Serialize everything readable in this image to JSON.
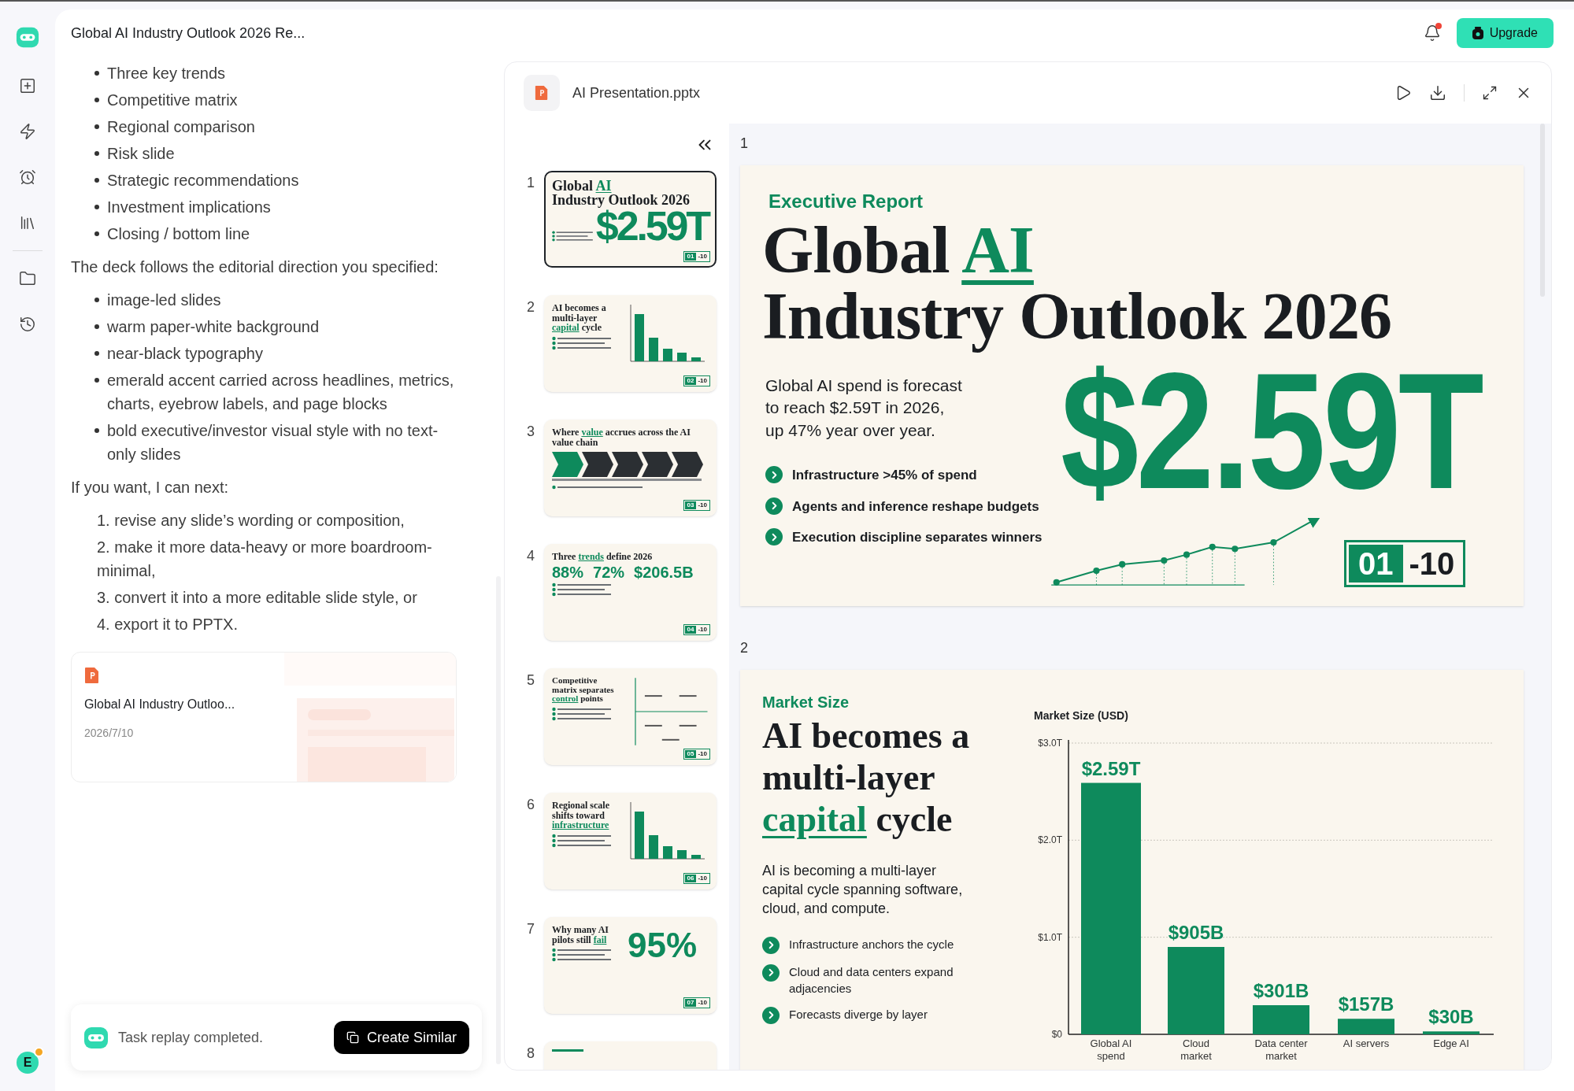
{
  "app": {
    "title": "Global AI Industry Outlook 2026 Re...",
    "avatar_letter": "E",
    "upgrade_label": "Upgrade",
    "has_notification": true
  },
  "chat": {
    "blocks": [
      {
        "kind": "bullets",
        "items": [
          "Three key trends",
          "Competitive matrix",
          "Regional comparison",
          "Risk slide",
          "Strategic recommendations",
          "Investment implications",
          "Closing / bottom line"
        ]
      },
      {
        "kind": "paragraph",
        "text": "The deck follows the editorial direction you specified:"
      },
      {
        "kind": "bullets",
        "items": [
          "image-led slides",
          "warm paper-white background",
          "near-black typography",
          "emerald accent carried across headlines, metrics, charts, eyebrow labels, and page blocks",
          "bold executive/investor visual style with no text-only slides"
        ]
      },
      {
        "kind": "paragraph",
        "text": "If you want, I can next:"
      },
      {
        "kind": "numbered",
        "items": [
          "1. revise any slide’s wording or composition,",
          "2. make it more data-heavy or more boardroom-minimal,",
          "3. convert it into a more editable slide style, or",
          "4. export it to PPTX."
        ]
      }
    ],
    "file_card": {
      "name": "Global AI Industry Outloo...",
      "date": "2026/7/10"
    },
    "status": {
      "text": "Task replay completed.",
      "button": "Create Similar"
    }
  },
  "preview": {
    "file_name": "AI Presentation.pptx",
    "thumbnails": [
      {
        "kind": "cover",
        "number": "1",
        "selected": true,
        "title": {
          "before": "Global ",
          "accent": "AI",
          "after": "\nIndustry Outlook 2026"
        },
        "stat": "$2.59T",
        "page": "01",
        "total": "-10"
      },
      {
        "kind": "bars",
        "number": "2",
        "selected": false,
        "title": {
          "before": "AI becomes a multi-layer ",
          "accent": "capital",
          "after": " cycle"
        },
        "page": "02",
        "total": "-10"
      },
      {
        "kind": "chain",
        "number": "3",
        "selected": false,
        "title": {
          "before": "Where ",
          "accent": "value",
          "after": " accrues across the AI value chain"
        },
        "page": "03",
        "total": "-10"
      },
      {
        "kind": "stats",
        "number": "4",
        "selected": false,
        "title": {
          "before": "Three ",
          "accent": "trends",
          "after": " define 2026"
        },
        "stats": [
          "88%",
          "72%",
          "$206.5B"
        ],
        "page": "04",
        "total": "-10"
      },
      {
        "kind": "matrix",
        "number": "5",
        "selected": false,
        "title": {
          "before": "Competitive matrix separates ",
          "accent": "control",
          "after": " points"
        },
        "page": "05",
        "total": "-10"
      },
      {
        "kind": "bars",
        "number": "6",
        "selected": false,
        "title": {
          "before": "Regional scale shifts toward ",
          "accent": "infrastructure"
        },
        "page": "06",
        "total": "-10"
      },
      {
        "kind": "stat",
        "number": "7",
        "selected": false,
        "title": {
          "before": "Why many AI pilots still ",
          "accent": "fail"
        },
        "stat": "95%",
        "page": "07",
        "total": "-10"
      },
      {
        "kind": "partial",
        "number": "8",
        "selected": false
      }
    ],
    "slides": [
      {
        "kind": "cover",
        "number": "1",
        "eyebrow": "Executive Report",
        "title": {
          "before": "Global ",
          "accent": "AI",
          "after": "\nIndustry Outlook 2026"
        },
        "summary": "Global AI spend is forecast\nto reach $2.59T in 2026,\nup 47% year over year.",
        "points": [
          "Infrastructure >45% of spend",
          "Agents and inference reshape budgets",
          "Execution discipline separates winners"
        ],
        "stat": "$2.59T",
        "page": "01",
        "total": "-10"
      },
      {
        "kind": "chart",
        "number": "2",
        "eyebrow": "Market Size",
        "title": {
          "before": "AI becomes a\nmulti-layer\n",
          "accent": "capital",
          "after": " cycle"
        },
        "summary": "AI is becoming a multi-layer\ncapital cycle spanning software,\ncloud, and compute.",
        "points": [
          "Infrastructure anchors the cycle",
          "Cloud and data centers expand adjacencies",
          "Forecasts diverge by layer"
        ],
        "chart_data": {
          "type": "bar",
          "title": "Market Size (USD)",
          "categories": [
            "Global AI spend",
            "Cloud market",
            "Data center market",
            "AI servers",
            "Edge AI"
          ],
          "series": [
            {
              "color": "#0e8a5c",
              "values": [
                2.59,
                0.9,
                0.3,
                0.16,
                0.03
              ]
            }
          ],
          "ylim": [
            0,
            3
          ],
          "yticks": [
            {
              "value": 0,
              "label": "$0"
            },
            {
              "value": 1,
              "label": "$1.0T"
            },
            {
              "value": 2,
              "label": "$2.0T"
            },
            {
              "value": 3,
              "label": "$3.0T"
            }
          ],
          "value_labels": [
            "$2.59T",
            "$905B",
            "$301B",
            "$157B",
            "$30B"
          ]
        }
      }
    ]
  }
}
